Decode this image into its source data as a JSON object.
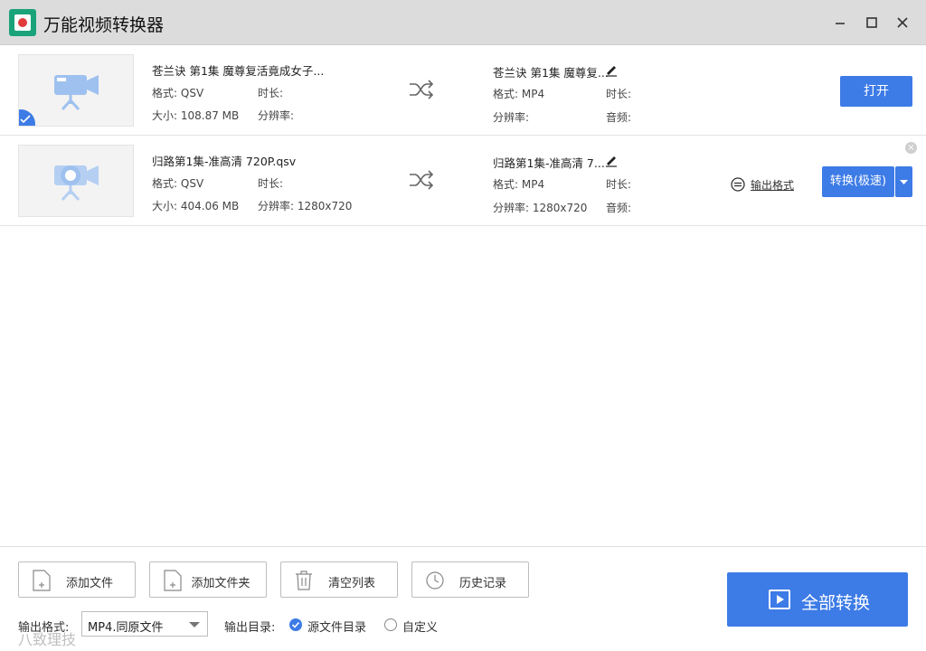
{
  "app": {
    "title": "万能视频转换器",
    "window_controls": [
      "minimize-icon",
      "maximize-icon",
      "close-icon"
    ]
  },
  "files": [
    {
      "name": "苍兰诀 第1集 魔尊复活竟成女子...",
      "format_label": "格式:",
      "format": "QSV",
      "size_label": "大小:",
      "size": "108.87 MB",
      "duration_label": "时长:",
      "duration": "",
      "resolution_label": "分辨率:",
      "resolution": "",
      "output_name": "苍兰诀 第1集 魔尊复...",
      "output_format": "MP4",
      "output_resolution": "",
      "output_duration": "",
      "audio_label": "音频:",
      "audio": "",
      "checked": true,
      "action_label": "打开"
    },
    {
      "name": "归路第1集-准高清 720P.qsv",
      "format_label": "格式:",
      "format": "QSV",
      "size_label": "大小:",
      "size": "404.06 MB",
      "duration_label": "时长:",
      "duration": "",
      "resolution_label": "分辨率:",
      "resolution": "1280x720",
      "output_name": "归路第1集-准高清 7...",
      "output_format": "MP4",
      "output_resolution": "1280x720",
      "output_duration": "",
      "audio_label": "音频:",
      "audio": "",
      "checked": false,
      "output_format_link": "输出格式",
      "action_label": "转换(极速)"
    }
  ],
  "toolbar": {
    "add_file": "添加文件",
    "add_folder": "添加文件夹",
    "clear_list": "清空列表",
    "history": "历史记录"
  },
  "output": {
    "format_label": "输出格式:",
    "format_value": "MP4.同原文件",
    "dir_label": "输出目录:",
    "dir_option_source": "源文件目录",
    "dir_option_custom": "自定义",
    "selected": "源文件目录"
  },
  "convert_all_label": "全部转换",
  "watermark": "八致理技",
  "colors": {
    "accent": "#3d7be6",
    "titlebar": "#dcdcdc",
    "logo": "#1aa37a"
  }
}
